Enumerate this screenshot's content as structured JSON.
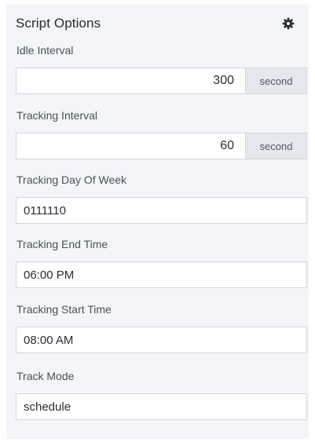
{
  "panel": {
    "title": "Script Options",
    "settings_icon": "gear-icon"
  },
  "fields": {
    "idle_interval": {
      "label": "Idle Interval",
      "value": "300",
      "unit": "second"
    },
    "tracking_interval": {
      "label": "Tracking Interval",
      "value": "60",
      "unit": "second"
    },
    "tracking_day_of_week": {
      "label": "Tracking Day Of Week",
      "value": "0111110"
    },
    "tracking_end_time": {
      "label": "Tracking End Time",
      "value": "06:00 PM"
    },
    "tracking_start_time": {
      "label": "Tracking Start Time",
      "value": "08:00 AM"
    },
    "track_mode": {
      "label": "Track Mode",
      "value": "schedule"
    }
  },
  "colors": {
    "panel_background": "#f4f5f9",
    "addon_background": "#e4e7ec",
    "border": "#d3d6dd",
    "text": "#262a33"
  }
}
